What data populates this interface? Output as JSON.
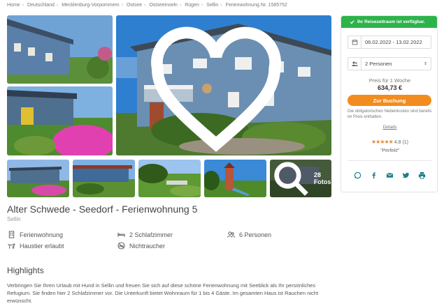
{
  "breadcrumb": [
    "Home",
    "Deutschland",
    "Mecklenburg-Vorpommern",
    "Ostsee",
    "Ostseeinseln",
    "Rügen",
    "Sellin",
    "Ferienwohnung Nr. 1585752"
  ],
  "gallery": {
    "more_photos": "28 Fotos"
  },
  "listing": {
    "title": "Alter Schwede - Seedorf - Ferienwohnung 5",
    "location": "Sellin",
    "features": {
      "type": "Ferienwohnung",
      "bedrooms": "2 Schlafzimmer",
      "persons": "6 Personen",
      "pets": "Haustier erlaubt",
      "smoking": "Nichtraucher"
    }
  },
  "highlights": {
    "heading": "Highlights",
    "text": "Verbringen Sie Ihren Urlaub mit Hund in Sellin und freuen Sie sich auf diese schöne Ferienwohnung mit Seeblick als Ihr persönliches Refugium. Sie finden hier 2 Schlafzimmer vor. Die Unterkunft bietet Wohnraum für 1 bis 4 Gäste. Im gesamten Haus ist Rauchen nicht erwünscht."
  },
  "booking": {
    "availability": "Ihr Reisezeitraum ist verfügbar.",
    "dates": "06.02.2022 - 13.02.2022",
    "guests": "2 Personen",
    "price_label": "Preis für 1 Woche",
    "price": "634,73 €",
    "book_button": "Zur Buchung",
    "note": "Die obligatorischen Nebenkosten sind bereits im Preis enthalten.",
    "details_link": "Details",
    "rating_stars": "★★★★★",
    "rating_value": "4.8 (1)",
    "rating_quote": "\"Perfekt\""
  },
  "colors": {
    "available_green": "#2cb34a",
    "book_orange": "#f28c1e",
    "share_teal": "#1e7d8c",
    "star_orange": "#e8872a"
  }
}
